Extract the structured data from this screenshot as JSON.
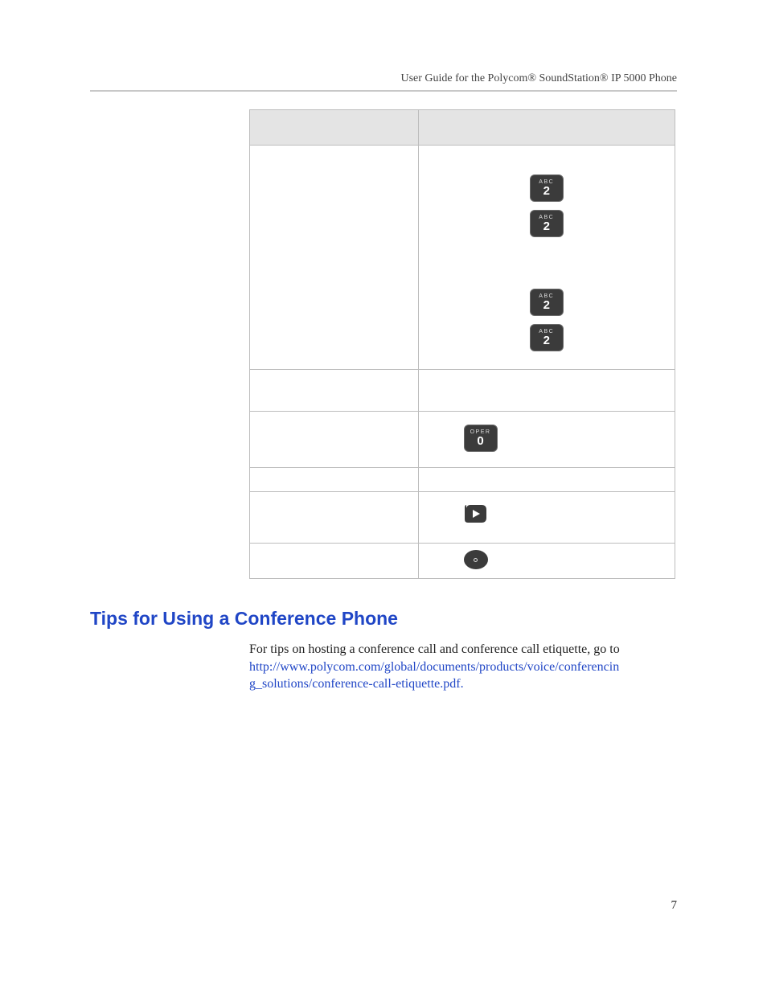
{
  "header": {
    "running_title": "User Guide for the Polycom® SoundStation® IP 5000 Phone"
  },
  "keys": {
    "abc2_sup": "ABC",
    "abc2_main": "2",
    "oper0_sup": "OPER",
    "oper0_main": "0"
  },
  "section": {
    "title": "Tips for Using a Conference Phone",
    "intro": "For tips on hosting a conference call and conference call etiquette, go to ",
    "link_part1": "http://www.polycom.com/global/documents/products/voice/conferencin",
    "link_part2": "g_solutions/conference-call-etiquette.pdf.",
    "link_href": "http://www.polycom.com/global/documents/products/voice/conferencing_solutions/conference-call-etiquette.pdf"
  },
  "page_number": "7"
}
